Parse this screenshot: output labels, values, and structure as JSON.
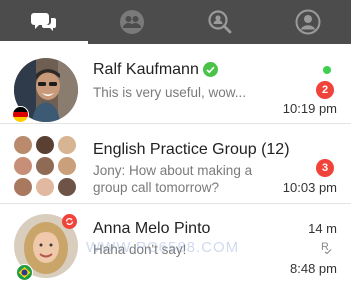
{
  "tabs": [
    {
      "icon": "chat-bubbles-icon",
      "active": true
    },
    {
      "icon": "contacts-icon",
      "active": false
    },
    {
      "icon": "search-people-icon",
      "active": false
    },
    {
      "icon": "profile-icon",
      "active": false
    }
  ],
  "conversations": [
    {
      "name": "Ralf Kaufmann",
      "snippet": "This is very useful, wow...",
      "time": "10:19 pm",
      "unread": "2",
      "flag": "germany",
      "online": true,
      "verified": true
    },
    {
      "name": "English Practice Group (12)",
      "snippet_line1": "Jony: How about making a",
      "snippet_line2": "group call tomorrow?",
      "time": "10:03 pm",
      "unread": "3"
    },
    {
      "name": "Anna Melo Pinto",
      "snippet": "Haha don't say!",
      "status_time": "14 m",
      "time": "8:48 pm",
      "flag": "brazil"
    }
  ],
  "watermark": "WWW.PC6588.COM",
  "colors": {
    "topbar": "#4c4c4c",
    "badge": "#f0433a",
    "online": "#3ecf4e",
    "verified": "#4bc34a"
  }
}
